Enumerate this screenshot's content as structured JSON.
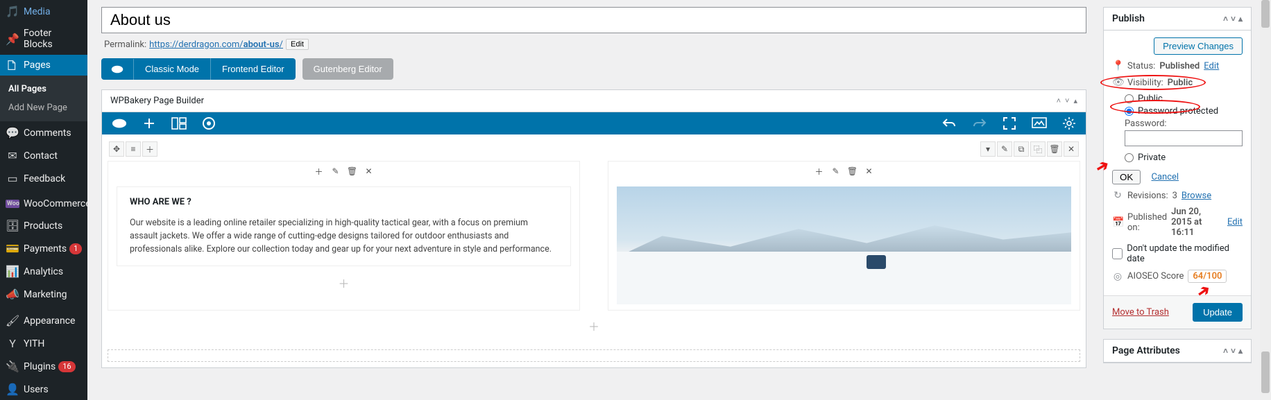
{
  "sidebar": {
    "items": [
      {
        "icon": "media",
        "label": "Media"
      },
      {
        "icon": "footer",
        "label": "Footer Blocks"
      },
      {
        "icon": "pages",
        "label": "Pages",
        "active": true
      },
      {
        "icon": "comments",
        "label": "Comments"
      },
      {
        "icon": "contact",
        "label": "Contact"
      },
      {
        "icon": "feedback",
        "label": "Feedback"
      },
      {
        "icon": "woo",
        "label": "WooCommerce"
      },
      {
        "icon": "products",
        "label": "Products"
      },
      {
        "icon": "payments",
        "label": "Payments",
        "badge": "1"
      },
      {
        "icon": "analytics",
        "label": "Analytics"
      },
      {
        "icon": "marketing",
        "label": "Marketing"
      },
      {
        "icon": "appearance",
        "label": "Appearance"
      },
      {
        "icon": "yith",
        "label": "YITH"
      },
      {
        "icon": "plugins",
        "label": "Plugins",
        "badge": "16"
      },
      {
        "icon": "users",
        "label": "Users"
      }
    ],
    "sub": [
      {
        "label": "All Pages",
        "current": true
      },
      {
        "label": "Add New Page"
      }
    ]
  },
  "main": {
    "title": "About us",
    "permalink_label": "Permalink:",
    "permalink_base": "https://derdragon.com/",
    "permalink_slug": "about-us",
    "permalink_tail": "/",
    "edit_btn": "Edit",
    "modes": {
      "classic": "Classic Mode",
      "frontend": "Frontend Editor",
      "gutenberg": "Gutenberg Editor"
    },
    "wpbakery_title": "WPBakery Page Builder",
    "content": {
      "heading": "WHO ARE WE ?",
      "body": "Our website is a leading online retailer specializing in high-quality tactical gear, with a focus on premium assault jackets. We offer a wide range of cutting-edge designs tailored for outdoor enthusiasts and professionals alike. Explore our collection today and gear up for your next adventure in style and performance."
    }
  },
  "publish": {
    "box_title": "Publish",
    "preview_btn": "Preview Changes",
    "status_label": "Status:",
    "status_value": "Published",
    "status_edit": "Edit",
    "visibility_label": "Visibility:",
    "visibility_value": "Public",
    "opt_public": "Public",
    "opt_password": "Password protected",
    "opt_private": "Private",
    "password_label": "Password:",
    "ok_btn": "OK",
    "cancel_link": "Cancel",
    "revisions_label": "Revisions:",
    "revisions_count": "3",
    "revisions_browse": "Browse",
    "published_on_label": "Published on:",
    "published_on_value": "Jun 20, 2015 at 16:11",
    "published_on_edit": "Edit",
    "dont_update_label": "Don't update the modified date",
    "aioseo_label": "AIOSEO Score",
    "aioseo_value": "64/100",
    "trash_link": "Move to Trash",
    "update_btn": "Update"
  },
  "page_attrs": {
    "box_title": "Page Attributes"
  }
}
